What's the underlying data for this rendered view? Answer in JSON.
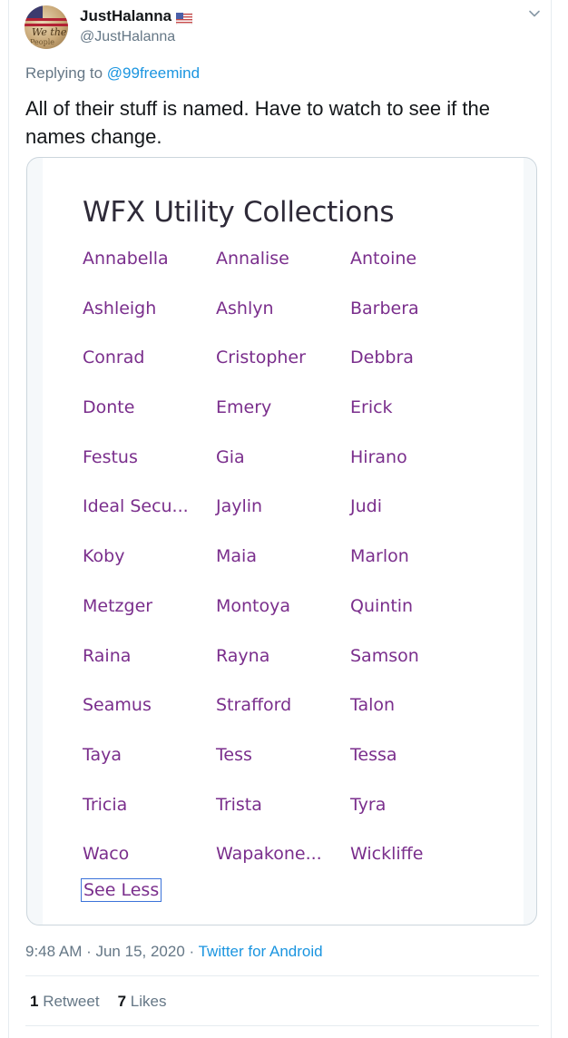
{
  "tweet": {
    "display_name": "JustHalanna",
    "handle": "@JustHalanna",
    "replying_prefix": "Replying to ",
    "replying_to": "@99freemind",
    "text": "All of their stuff is named. Have to watch to see if the names change.",
    "time": "9:48 AM · Jun 15, 2020 · ",
    "source": "Twitter for Android",
    "retweet_count": "1",
    "retweet_label": "Retweet",
    "like_count": "7",
    "like_label": "Likes"
  },
  "media": {
    "title": "WFX Utility Collections",
    "names": [
      "Annabella",
      "Annalise",
      "Antoine",
      "Ashleigh",
      "Ashlyn",
      "Barbera",
      "Conrad",
      "Cristopher",
      "Debbra",
      "Donte",
      "Emery",
      "Erick",
      "Festus",
      "Gia",
      "Hirano",
      "Ideal Secu...",
      "Jaylin",
      "Judi",
      "Koby",
      "Maia",
      "Marlon",
      "Metzger",
      "Montoya",
      "Quintin",
      "Raina",
      "Rayna",
      "Samson",
      "Seamus",
      "Strafford",
      "Talon",
      "Taya",
      "Tess",
      "Tessa",
      "Tricia",
      "Trista",
      "Tyra",
      "Waco",
      "Wapakone...",
      "Wickliffe"
    ],
    "see_less": "See Less"
  },
  "colors": {
    "link_purple": "#7a2e8c",
    "twitter_blue": "#1b95e0",
    "muted_gray": "#657786"
  },
  "icons": {
    "flag": "us-flag-icon",
    "menu": "chevron-down-icon"
  }
}
